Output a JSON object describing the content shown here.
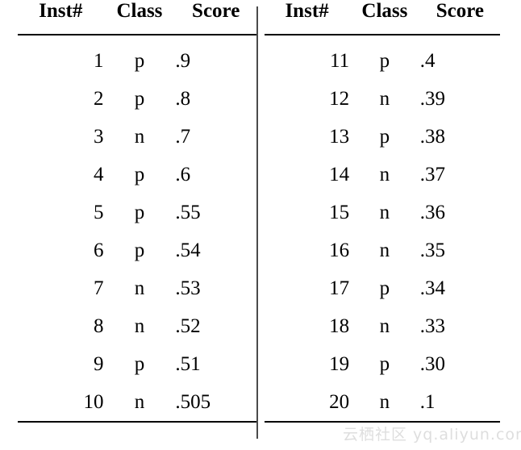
{
  "table": {
    "columns": [
      "Inst#",
      "Class",
      "Score"
    ],
    "left_rows": [
      {
        "inst": "1",
        "class": "p",
        "score": ".9"
      },
      {
        "inst": "2",
        "class": "p",
        "score": ".8"
      },
      {
        "inst": "3",
        "class": "n",
        "score": ".7"
      },
      {
        "inst": "4",
        "class": "p",
        "score": ".6"
      },
      {
        "inst": "5",
        "class": "p",
        "score": ".55"
      },
      {
        "inst": "6",
        "class": "p",
        "score": ".54"
      },
      {
        "inst": "7",
        "class": "n",
        "score": ".53"
      },
      {
        "inst": "8",
        "class": "n",
        "score": ".52"
      },
      {
        "inst": "9",
        "class": "p",
        "score": ".51"
      },
      {
        "inst": "10",
        "class": "n",
        "score": ".505"
      }
    ],
    "right_rows": [
      {
        "inst": "11",
        "class": "p",
        "score": ".4"
      },
      {
        "inst": "12",
        "class": "n",
        "score": ".39"
      },
      {
        "inst": "13",
        "class": "p",
        "score": ".38"
      },
      {
        "inst": "14",
        "class": "n",
        "score": ".37"
      },
      {
        "inst": "15",
        "class": "n",
        "score": ".36"
      },
      {
        "inst": "16",
        "class": "n",
        "score": ".35"
      },
      {
        "inst": "17",
        "class": "p",
        "score": ".34"
      },
      {
        "inst": "18",
        "class": "n",
        "score": ".33"
      },
      {
        "inst": "19",
        "class": "p",
        "score": ".30"
      },
      {
        "inst": "20",
        "class": "n",
        "score": ".1"
      }
    ]
  },
  "watermark": {
    "text": "云栖社区 yq.aliyun.com",
    "color": "#dedede"
  }
}
